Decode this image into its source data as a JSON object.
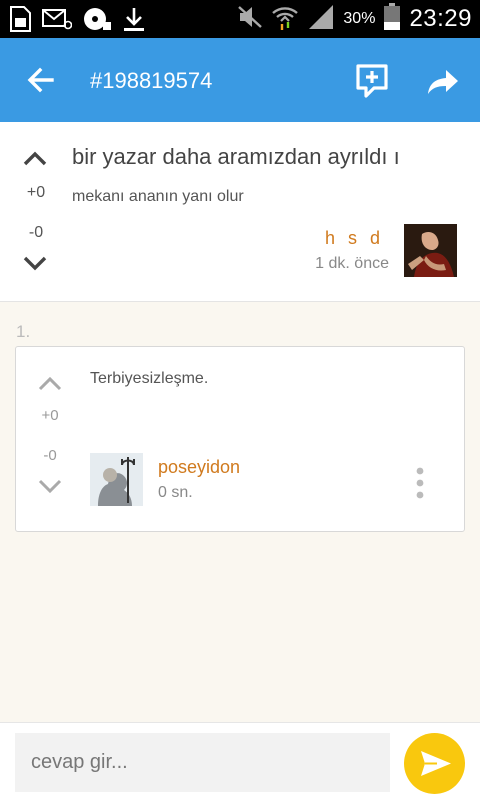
{
  "status_bar": {
    "battery_percent": "30%",
    "time": "23:29",
    "icons": [
      "sim-card-icon",
      "message-icon",
      "disc-icon",
      "download-icon",
      "mute-icon",
      "wifi-icon",
      "signal-icon",
      "battery-icon"
    ]
  },
  "app_bar": {
    "title": "#198819574",
    "back_icon": "arrow-left-icon",
    "add_icon": "add-comment-icon",
    "share_icon": "share-icon",
    "color": "#3a9ae3"
  },
  "post": {
    "title": "bir yazar daha aramızdan ayrıldı ı",
    "body": "mekanı ananın yanı olur",
    "upvotes": "+0",
    "downvotes": "-0",
    "author": "h s d",
    "time": "1 dk. önce"
  },
  "reply": {
    "index": "1.",
    "text": "Terbiyesizleşme.",
    "upvotes": "+0",
    "downvotes": "-0",
    "author": "poseyidon",
    "time": "0 sn."
  },
  "composer": {
    "placeholder": "cevap gir...",
    "send_color": "#f9c80e"
  },
  "colors": {
    "accent_orange": "#d07a1e"
  }
}
